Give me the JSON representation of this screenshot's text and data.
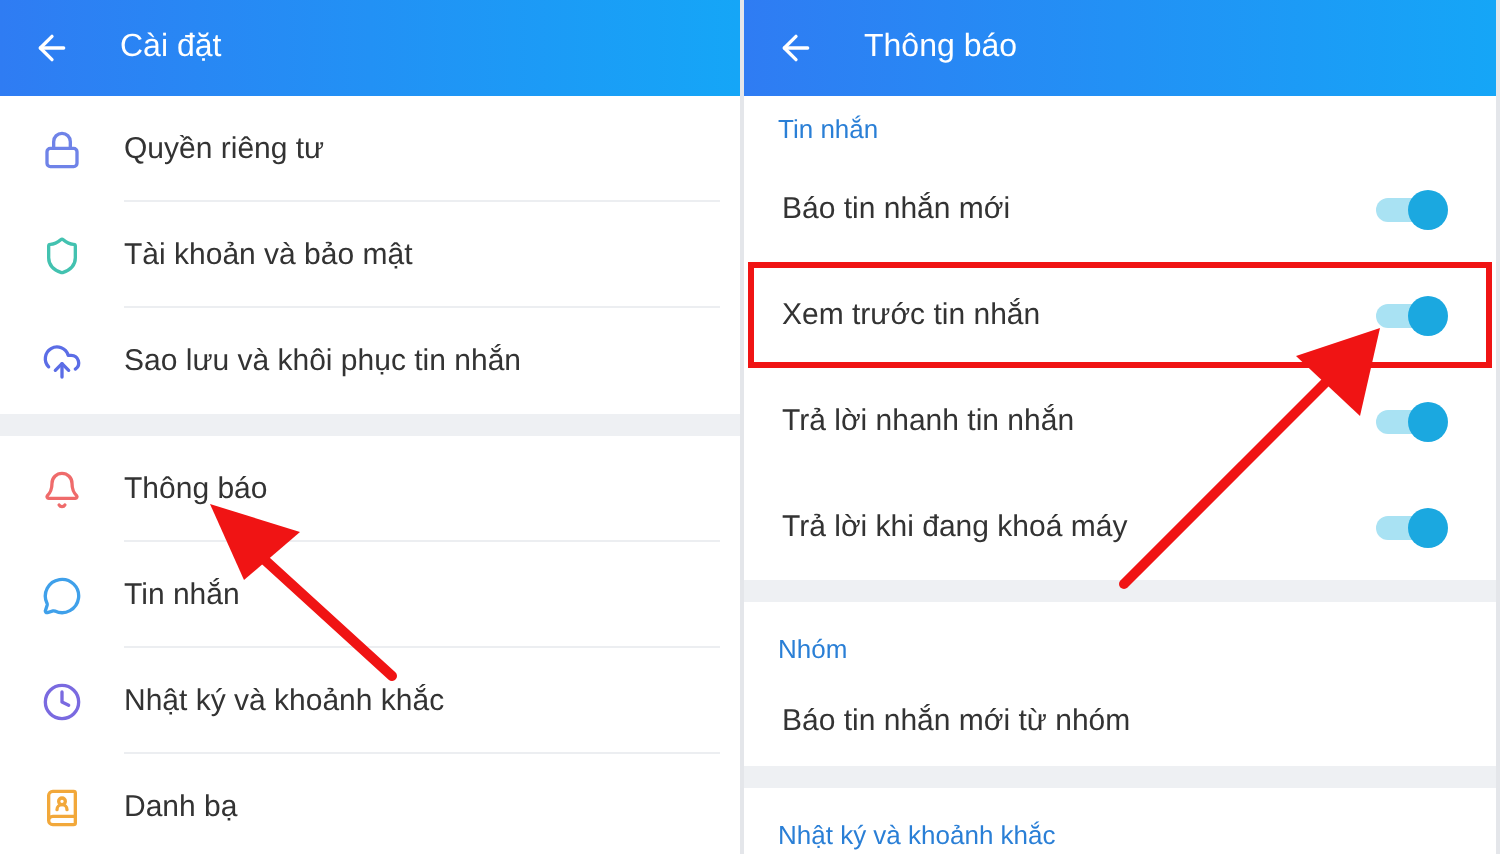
{
  "settings_screen": {
    "title": "Cài đặt",
    "groups": [
      {
        "items": [
          {
            "label": "Quyền riêng tư"
          },
          {
            "label": "Tài khoản và bảo mật"
          },
          {
            "label": "Sao lưu và khôi phục tin nhắn"
          }
        ]
      },
      {
        "items": [
          {
            "label": "Thông báo"
          },
          {
            "label": "Tin nhắn"
          },
          {
            "label": "Nhật ký và khoảnh khắc"
          },
          {
            "label": "Danh bạ"
          }
        ]
      }
    ]
  },
  "notifications_screen": {
    "title": "Thông báo",
    "sections": [
      {
        "title": "Tin nhắn",
        "rows": [
          {
            "label": "Báo tin nhắn mới",
            "on": true,
            "highlighted": false
          },
          {
            "label": "Xem trước tin nhắn",
            "on": true,
            "highlighted": true
          },
          {
            "label": "Trả lời nhanh tin nhắn",
            "on": true,
            "highlighted": false
          },
          {
            "label": "Trả lời khi đang khoá máy",
            "on": true,
            "highlighted": false
          }
        ]
      },
      {
        "title": "Nhóm",
        "rows": [
          {
            "label": "Báo tin nhắn mới từ nhóm",
            "highlighted": false
          }
        ]
      },
      {
        "title": "Nhật ký và khoảnh khắc"
      }
    ]
  }
}
